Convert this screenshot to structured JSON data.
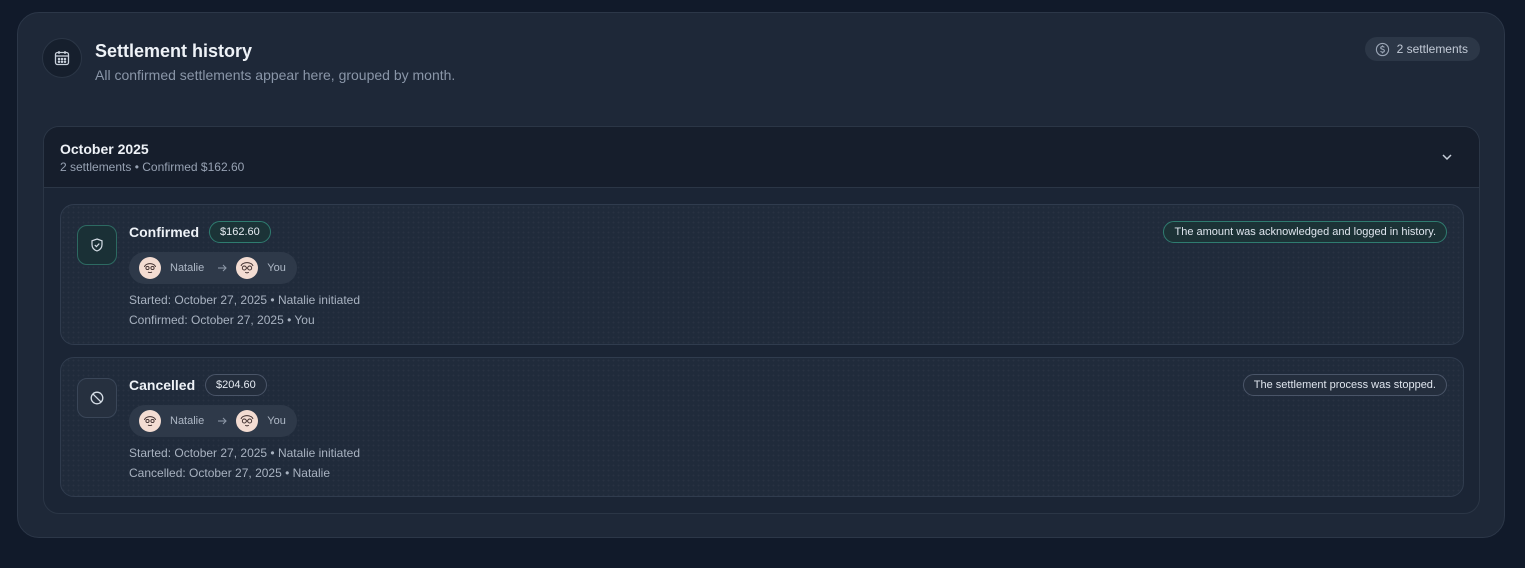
{
  "header": {
    "icon": "calendar-icon",
    "title": "Settlement history",
    "subtitle": "All confirmed settlements appear here, grouped by month.",
    "count_icon": "dollar-circle-icon",
    "count_label": "2 settlements"
  },
  "group": {
    "title": "October 2025",
    "summary": "2 settlements • Confirmed $162.60",
    "toggle_icon": "chevron-down-icon"
  },
  "settlements": [
    {
      "status": "Confirmed",
      "status_icon": "shield-check-icon",
      "amount": "$162.60",
      "from": "Natalie",
      "to": "You",
      "started": "Started: October 27, 2025 • Natalie initiated",
      "resolved": "Confirmed: October 27, 2025 • You",
      "note": "The amount was acknowledged and logged in history.",
      "accent": "#2f7c70"
    },
    {
      "status": "Cancelled",
      "status_icon": "ban-icon",
      "amount": "$204.60",
      "from": "Natalie",
      "to": "You",
      "started": "Started: October 27, 2025 • Natalie initiated",
      "resolved": "Cancelled: October 27, 2025 • Natalie",
      "note": "The settlement process was stopped.",
      "accent": "#4a5568"
    }
  ],
  "colors": {
    "background": "#111a2a",
    "panel": "#1e2838",
    "confirmed_accent": "#2f7c70"
  }
}
